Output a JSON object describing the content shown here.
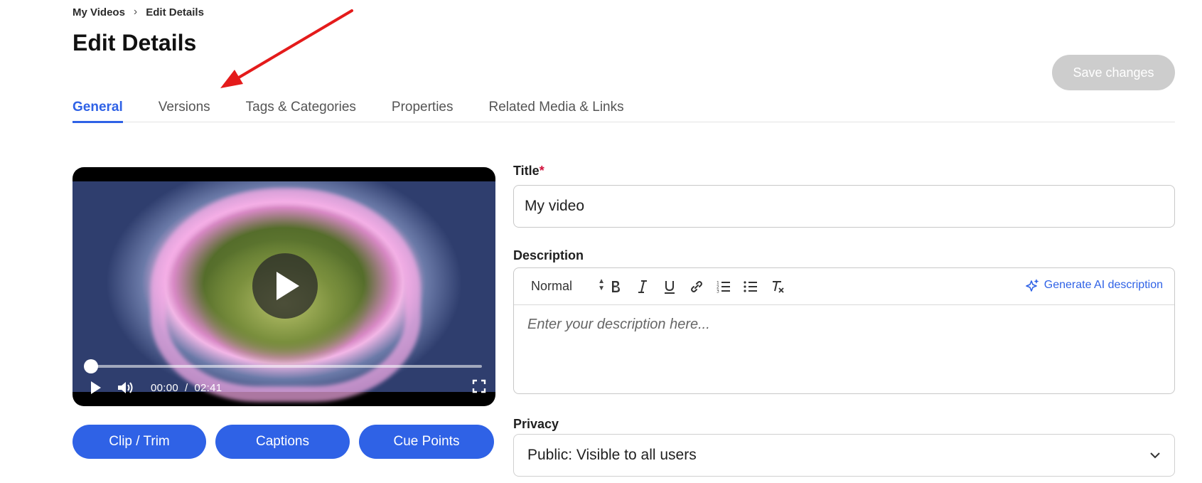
{
  "breadcrumb": {
    "root": "My Videos",
    "separator": "›",
    "current": "Edit Details"
  },
  "page": {
    "title": "Edit Details"
  },
  "header": {
    "save_label": "Save changes"
  },
  "tabs": [
    {
      "label": "General",
      "active": true
    },
    {
      "label": "Versions",
      "active": false
    },
    {
      "label": "Tags & Categories",
      "active": false
    },
    {
      "label": "Properties",
      "active": false
    },
    {
      "label": "Related Media & Links",
      "active": false
    }
  ],
  "player": {
    "current_time": "00:00",
    "time_separator": "/",
    "duration": "02:41",
    "progress_fraction": 0
  },
  "actions": {
    "clip_label": "Clip / Trim",
    "captions_label": "Captions",
    "cue_label": "Cue Points"
  },
  "form": {
    "title_label": "Title",
    "title_required_mark": "*",
    "title_value": "My video",
    "description_label": "Description",
    "description_placeholder": "Enter your description here...",
    "format_label": "Normal",
    "generate_ai_label": "Generate AI description",
    "privacy_label": "Privacy",
    "privacy_value": "Public: Visible to all users"
  },
  "colors": {
    "accent": "#2f62e6",
    "disabled": "#cdcdcd",
    "required": "#d0103a",
    "annotation_arrow": "#e41b1b"
  },
  "icons": [
    "play-icon",
    "volume-icon",
    "fullscreen-icon",
    "bold-icon",
    "italic-icon",
    "underline-icon",
    "link-icon",
    "ordered-list-icon",
    "bullet-list-icon",
    "clear-format-icon",
    "sparkle-icon",
    "chevron-down-icon"
  ]
}
